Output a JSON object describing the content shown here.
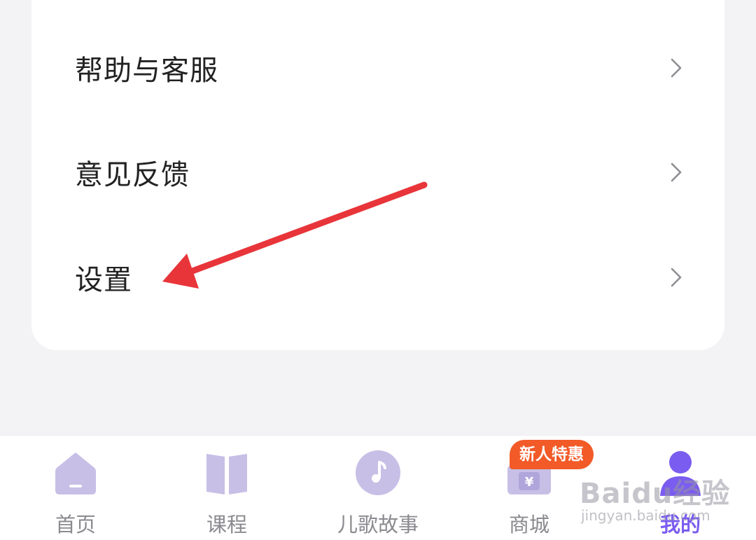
{
  "menu": {
    "items": [
      {
        "label": "帮助与客服"
      },
      {
        "label": "意见反馈"
      },
      {
        "label": "设置"
      }
    ]
  },
  "tabbar": {
    "tabs": [
      {
        "label": "首页",
        "icon": "home-icon",
        "active": false
      },
      {
        "label": "课程",
        "icon": "book-icon",
        "active": false
      },
      {
        "label": "儿歌故事",
        "icon": "music-note-icon",
        "active": false
      },
      {
        "label": "商城",
        "icon": "shopping-bag-icon",
        "active": false
      },
      {
        "label": "我的",
        "icon": "user-profile-icon",
        "active": true
      }
    ],
    "promo_badge": "新人特惠"
  },
  "watermark": {
    "logo_text": "Baidu经验",
    "url_text": "jingyan.baidu.com"
  },
  "colors": {
    "accent": "#7b5cf0",
    "icon_fill": "#c7bfe6",
    "annotation_arrow": "#e8353a",
    "promo_badge": "#f25a28",
    "background": "#f3f3f5"
  }
}
